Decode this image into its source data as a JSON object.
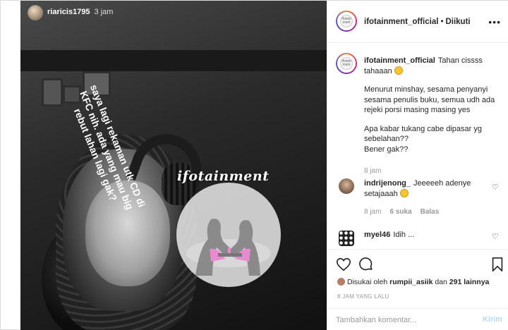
{
  "story": {
    "username": "riaricis1795",
    "time": "3 jam",
    "overlay_text": "saya lagi rekaman utk CD di KFC nih. ada yang mau big rebut lahan lagi gak?",
    "watermark": "ifotainment"
  },
  "post": {
    "account": "ifotainment_official",
    "separator": "•",
    "follow_status": "Diikuti",
    "avatar_logo_text": "ifotain ment",
    "caption": {
      "username": "ifotainment_official",
      "line1": "Tahan cissss tahaaan",
      "para2": "Menurut minshay, sesama penyanyi sesama penulis buku, semua udh ada rejeki porsi masing masing yes",
      "para3a": "Apa kabar tukang cabe dipasar yg sebelahan??",
      "para3b": "Bener gak??",
      "time": "8 jam"
    },
    "comments": [
      {
        "username": "indrijenong_",
        "text": "Jeeeeeh adenye setajaaah",
        "time": "8 jam",
        "likes": "6 suka",
        "reply": "Balas"
      },
      {
        "username": "myel46",
        "text": "Idih ..."
      }
    ],
    "liked_by_prefix": "Disukai oleh",
    "liked_by_user": "rumpii_asiik",
    "liked_by_and": "dan",
    "liked_by_count": "291 lainnya",
    "posted_ago": "8 JAM YANG LALU",
    "comment_placeholder": "Tambahkan komentar...",
    "post_label": "Kirim"
  },
  "icons": {
    "heart": "heart-icon",
    "comment": "comment-icon",
    "bookmark": "bookmark-icon",
    "more": "more-icon"
  }
}
